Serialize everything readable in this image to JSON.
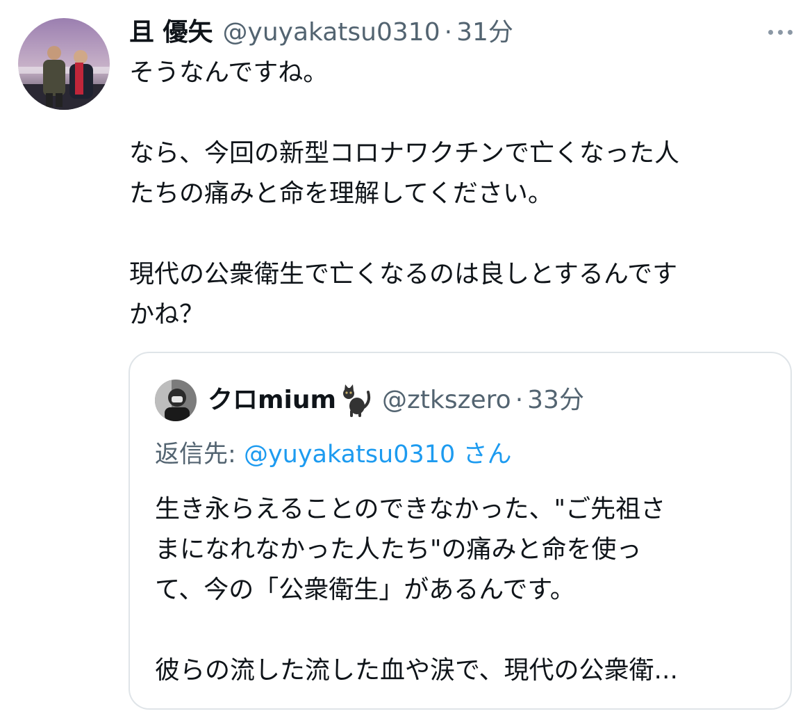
{
  "tweet": {
    "author": {
      "display_name": "且 優矢",
      "handle": "@yuyakatsu0310",
      "separator": "·",
      "time": "31分"
    },
    "more_icon": "more-horizontal-icon",
    "body_lines": [
      "そうなんですね。",
      "",
      "なら、今回の新型コロナワクチンで亡くなった人",
      "たちの痛みと命を理解してください。",
      "",
      "現代の公衆衛生で亡くなるのは良しとするんです",
      "かね？"
    ]
  },
  "quote": {
    "author": {
      "display_name": "クロmium",
      "emoji": "black-cat-emoji",
      "handle": "@ztkszero",
      "separator": "·",
      "time": "33分"
    },
    "reply_to": {
      "prefix": "返信先:",
      "mention": "@yuyakatsu0310",
      "suffix": "さん"
    },
    "body_lines": [
      "生き永らえることのできなかった、\"ご先祖さ",
      "まになれなかった人たち\"の痛みと命を使っ",
      "て、今の「公衆衛生」があるんです。",
      "",
      "彼らの流した流した血や涙で、現代の公衆衛..."
    ]
  },
  "colors": {
    "text_primary": "#0f1419",
    "text_secondary": "#536471",
    "link": "#1d9bf0",
    "border": "#dfe4e8"
  }
}
